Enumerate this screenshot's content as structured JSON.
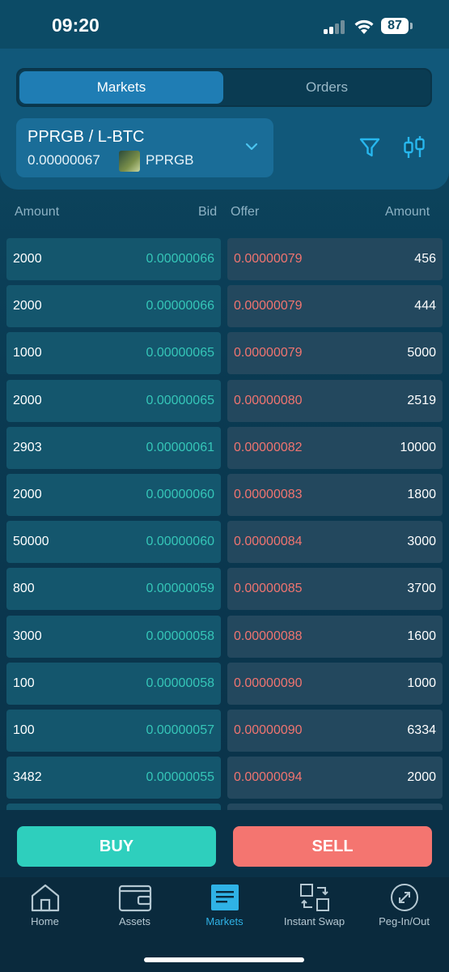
{
  "status": {
    "time": "09:20",
    "battery": "87"
  },
  "segmented": {
    "tabs": [
      {
        "label": "Markets",
        "active": true
      },
      {
        "label": "Orders",
        "active": false
      }
    ]
  },
  "pair": {
    "title": "PPRGB / L-BTC",
    "price": "0.00000067",
    "asset": "PPRGB"
  },
  "columns": {
    "bid_amount": "Amount",
    "bid": "Bid",
    "offer": "Offer",
    "offer_amount": "Amount"
  },
  "orderbook": {
    "bids": [
      {
        "amount": "2000",
        "price": "0.00000066"
      },
      {
        "amount": "2000",
        "price": "0.00000066"
      },
      {
        "amount": "1000",
        "price": "0.00000065"
      },
      {
        "amount": "2000",
        "price": "0.00000065"
      },
      {
        "amount": "2903",
        "price": "0.00000061"
      },
      {
        "amount": "2000",
        "price": "0.00000060"
      },
      {
        "amount": "50000",
        "price": "0.00000060"
      },
      {
        "amount": "800",
        "price": "0.00000059"
      },
      {
        "amount": "3000",
        "price": "0.00000058"
      },
      {
        "amount": "100",
        "price": "0.00000058"
      },
      {
        "amount": "100",
        "price": "0.00000057"
      },
      {
        "amount": "3482",
        "price": "0.00000055"
      }
    ],
    "offers": [
      {
        "price": "0.00000079",
        "amount": "456"
      },
      {
        "price": "0.00000079",
        "amount": "444"
      },
      {
        "price": "0.00000079",
        "amount": "5000"
      },
      {
        "price": "0.00000080",
        "amount": "2519"
      },
      {
        "price": "0.00000082",
        "amount": "10000"
      },
      {
        "price": "0.00000083",
        "amount": "1800"
      },
      {
        "price": "0.00000084",
        "amount": "3000"
      },
      {
        "price": "0.00000085",
        "amount": "3700"
      },
      {
        "price": "0.00000088",
        "amount": "1600"
      },
      {
        "price": "0.00000090",
        "amount": "1000"
      },
      {
        "price": "0.00000090",
        "amount": "6334"
      },
      {
        "price": "0.00000094",
        "amount": "2000"
      }
    ]
  },
  "actions": {
    "buy": "BUY",
    "sell": "SELL"
  },
  "tabbar": {
    "items": [
      {
        "label": "Home",
        "icon": "home-icon"
      },
      {
        "label": "Assets",
        "icon": "wallet-icon"
      },
      {
        "label": "Markets",
        "icon": "markets-icon",
        "active": true
      },
      {
        "label": "Instant Swap",
        "icon": "swap-icon"
      },
      {
        "label": "Peg-In/Out",
        "icon": "peg-icon"
      }
    ]
  },
  "colors": {
    "bid": "#35c6b8",
    "offer": "#f07470",
    "buy": "#2ecfbd",
    "sell": "#f47570",
    "accent": "#2fb2e6"
  }
}
